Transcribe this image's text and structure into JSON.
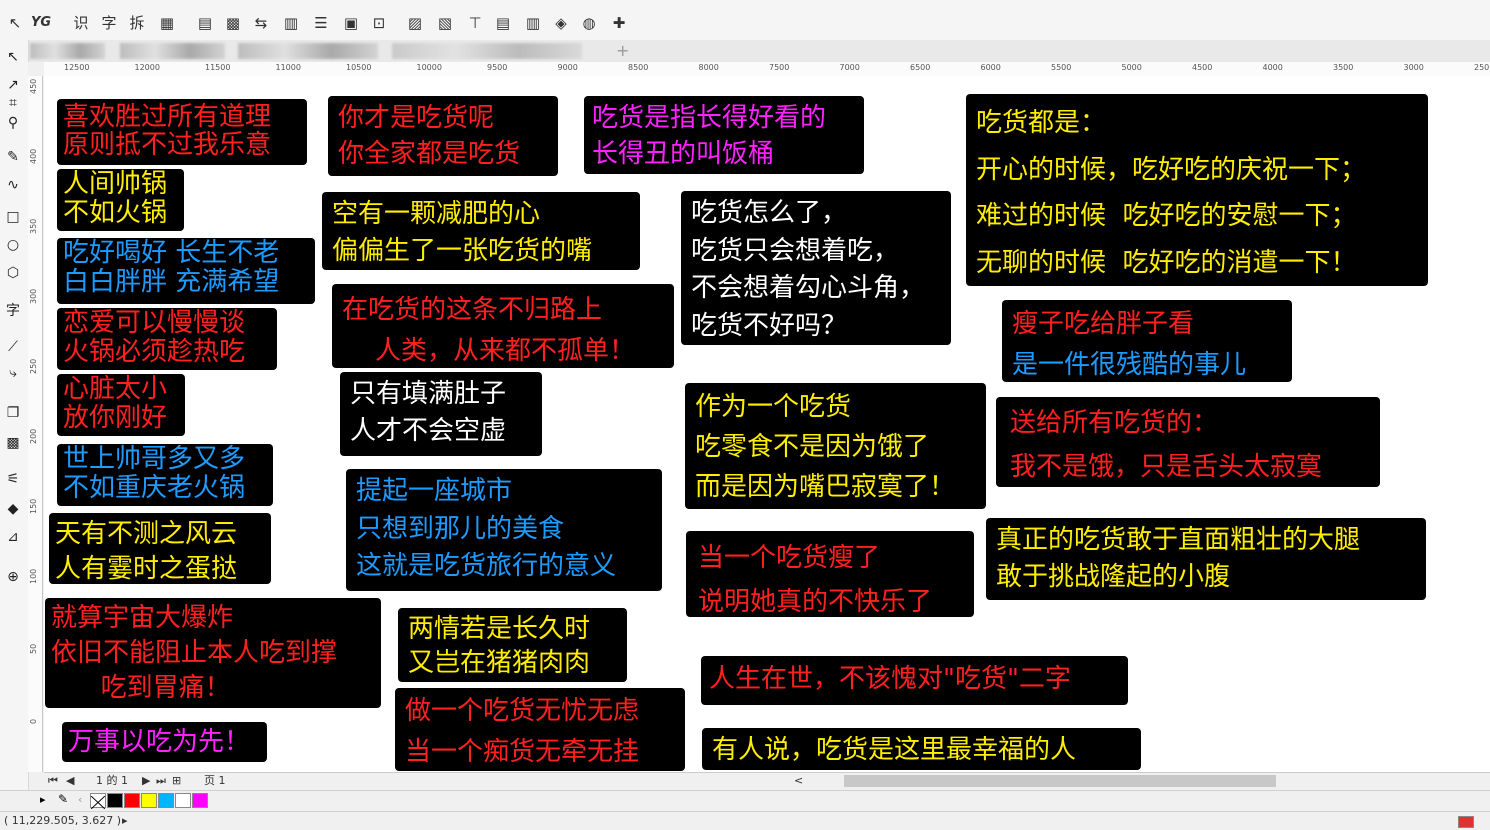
{
  "toolbar": {
    "items": [
      {
        "name": "pointer-icon",
        "glyph": "↖"
      },
      {
        "name": "yg-icon",
        "glyph": "YG"
      },
      {
        "name": "recognize-text-shi",
        "glyph": "识"
      },
      {
        "name": "recognize-text-zi",
        "glyph": "字"
      },
      {
        "name": "recognize-text-chai",
        "glyph": "拆"
      },
      {
        "name": "clipboard-icon",
        "glyph": "▦"
      },
      {
        "name": "document-icon",
        "glyph": "▤"
      },
      {
        "name": "grid-icon",
        "glyph": "▩"
      },
      {
        "name": "transform-icon",
        "glyph": "⇆"
      },
      {
        "name": "align-icon",
        "glyph": "▥"
      },
      {
        "name": "distribute-icon",
        "glyph": "☰"
      },
      {
        "name": "group-icon",
        "glyph": "▣"
      },
      {
        "name": "select-icon",
        "glyph": "⊡"
      },
      {
        "name": "color-icon",
        "glyph": "▨"
      },
      {
        "name": "image-icon",
        "glyph": "▧"
      },
      {
        "name": "text-tool-icon",
        "glyph": "⊤"
      },
      {
        "name": "layers-icon",
        "glyph": "▤"
      },
      {
        "name": "barcode-icon",
        "glyph": "▥"
      },
      {
        "name": "macro-icon",
        "glyph": "◈"
      },
      {
        "name": "globe-icon",
        "glyph": "◍"
      },
      {
        "name": "plugin-icon",
        "glyph": "✚"
      }
    ]
  },
  "tabs": {
    "add_label": "+"
  },
  "toolbox": [
    {
      "name": "pick-tool-icon",
      "glyph": "↖"
    },
    {
      "name": "shape-tool-icon",
      "glyph": "↗"
    },
    {
      "name": "crop-tool-icon",
      "glyph": "⌗"
    },
    {
      "name": "zoom-tool-icon",
      "glyph": "⚲"
    },
    {
      "name": "freehand-tool-icon",
      "glyph": "✎"
    },
    {
      "name": "artistic-media-icon",
      "glyph": "∿"
    },
    {
      "name": "rectangle-tool-icon",
      "glyph": "□"
    },
    {
      "name": "ellipse-tool-icon",
      "glyph": "○"
    },
    {
      "name": "polygon-tool-icon",
      "glyph": "⬡"
    },
    {
      "name": "text-tool-icon",
      "glyph": "字"
    },
    {
      "name": "parallel-dimension-icon",
      "glyph": "⟋"
    },
    {
      "name": "connector-tool-icon",
      "glyph": "⤷"
    },
    {
      "name": "drop-shadow-icon",
      "glyph": "❐"
    },
    {
      "name": "transparency-icon",
      "glyph": "▩"
    },
    {
      "name": "eyedropper-icon",
      "glyph": "⚟"
    },
    {
      "name": "interactive-fill-icon",
      "glyph": "◆"
    },
    {
      "name": "smart-fill-icon",
      "glyph": "⊿"
    },
    {
      "name": "add-tool-icon",
      "glyph": "⊕"
    }
  ],
  "ruler_h": [
    "12500",
    "12000",
    "11500",
    "11000",
    "10500",
    "10000",
    "9500",
    "9000",
    "8500",
    "8000",
    "7500",
    "7000",
    "6500",
    "6000",
    "5500",
    "5000",
    "4500",
    "4000",
    "3500",
    "3000",
    "250"
  ],
  "ruler_v": [
    "450",
    "400",
    "350",
    "300",
    "250",
    "200",
    "150",
    "100",
    "50",
    "0"
  ],
  "cards": [
    {
      "lines": [
        {
          "t": "喜欢胜过所有道理",
          "c": "#ff2020"
        },
        {
          "t": "原则抵不过我乐意",
          "c": "#ff2020"
        }
      ]
    },
    {
      "lines": [
        {
          "t": "你才是吃货呢",
          "c": "#ff2020"
        },
        {
          "t": "你全家都是吃货",
          "c": "#ff2020"
        }
      ]
    },
    {
      "lines": [
        {
          "t": "吃货是指长得好看的",
          "c": "#ff22ff"
        },
        {
          "t": "长得丑的叫饭桶",
          "c": "#ff22ff"
        }
      ]
    },
    {
      "lines": [
        {
          "t": "吃货都是：",
          "c": "#ffee00"
        },
        {
          "t": "开心的时候，吃好吃的庆祝一下；",
          "c": "#ffee00"
        },
        {
          "t": "难过的时候  吃好吃的安慰一下；",
          "c": "#ffee00"
        },
        {
          "t": "无聊的时候  吃好吃的消遣一下！",
          "c": "#ffee00"
        }
      ]
    },
    {
      "lines": [
        {
          "t": "人间帅锅",
          "c": "#ffee00"
        },
        {
          "t": "不如火锅",
          "c": "#ffee00"
        }
      ]
    },
    {
      "lines": [
        {
          "t": "空有一颗减肥的心",
          "c": "#ffee00"
        },
        {
          "t": "偏偏生了一张吃货的嘴",
          "c": "#ffee00"
        }
      ]
    },
    {
      "lines": [
        {
          "t": "吃货怎么了，",
          "c": "#ffffff"
        },
        {
          "t": "吃货只会想着吃，",
          "c": "#ffffff"
        },
        {
          "t": "不会想着勾心斗角，",
          "c": "#ffffff"
        },
        {
          "t": "吃货不好吗？",
          "c": "#ffffff"
        }
      ]
    },
    {
      "lines": [
        {
          "t": "吃好喝好 长生不老",
          "c": "#1e9bff"
        },
        {
          "t": "白白胖胖 充满希望",
          "c": "#1e9bff"
        }
      ]
    },
    {
      "lines": [
        {
          "t": "在吃货的这条不归路上",
          "c": "#ff2020"
        },
        {
          "t": "    人类，从来都不孤单！",
          "c": "#ff2020"
        }
      ]
    },
    {
      "lines": [
        {
          "t": "瘦子吃给胖子看",
          "c": "#ff2020"
        },
        {
          "t": "是一件很残酷的事儿",
          "c": "#1e9bff"
        }
      ]
    },
    {
      "lines": [
        {
          "t": "恋爱可以慢慢谈",
          "c": "#ff2020"
        },
        {
          "t": "火锅必须趁热吃",
          "c": "#ff2020"
        }
      ]
    },
    {
      "lines": [
        {
          "t": "只有填满肚子",
          "c": "#ffffff"
        },
        {
          "t": "人才不会空虚",
          "c": "#ffffff"
        }
      ]
    },
    {
      "lines": [
        {
          "t": "作为一个吃货",
          "c": "#ffee00"
        },
        {
          "t": "吃零食不是因为饿了",
          "c": "#ffee00"
        },
        {
          "t": "而是因为嘴巴寂寞了！",
          "c": "#ffee00"
        }
      ]
    },
    {
      "lines": [
        {
          "t": "心脏太小",
          "c": "#ff2020"
        },
        {
          "t": "放你刚好",
          "c": "#ff2020"
        }
      ]
    },
    {
      "lines": [
        {
          "t": "送给所有吃货的：",
          "c": "#ff2020"
        },
        {
          "t": "我不是饿，只是舌头太寂寞",
          "c": "#ff2020"
        }
      ]
    },
    {
      "lines": [
        {
          "t": "世上帅哥多又多",
          "c": "#1e9bff"
        },
        {
          "t": "不如重庆老火锅",
          "c": "#1e9bff"
        }
      ]
    },
    {
      "lines": [
        {
          "t": "提起一座城市",
          "c": "#1e9bff"
        },
        {
          "t": "只想到那儿的美食",
          "c": "#1e9bff"
        },
        {
          "t": "这就是吃货旅行的意义",
          "c": "#1e9bff"
        }
      ]
    },
    {
      "lines": [
        {
          "t": "天有不测之风云",
          "c": "#ffee00"
        },
        {
          "t": "人有霎时之蛋挞",
          "c": "#ffee00"
        }
      ]
    },
    {
      "lines": [
        {
          "t": "真正的吃货敢于直面粗壮的大腿",
          "c": "#ffee00"
        },
        {
          "t": "敢于挑战隆起的小腹",
          "c": "#ffee00"
        }
      ]
    },
    {
      "lines": [
        {
          "t": "当一个吃货瘦了",
          "c": "#ff2020"
        },
        {
          "t": "说明她真的不快乐了",
          "c": "#ff2020"
        }
      ]
    },
    {
      "lines": [
        {
          "t": "就算宇宙大爆炸",
          "c": "#ff2020"
        },
        {
          "t": "依旧不能阻止本人吃到撑",
          "c": "#ff2020"
        },
        {
          "t": "      吃到胃痛！",
          "c": "#ff2020"
        }
      ]
    },
    {
      "lines": [
        {
          "t": "两情若是长久时",
          "c": "#ffee00"
        },
        {
          "t": "又岂在猪猪肉肉",
          "c": "#ffee00"
        }
      ]
    },
    {
      "lines": [
        {
          "t": "人生在世，不该愧对\"吃货\"二字",
          "c": "#ff2020"
        }
      ]
    },
    {
      "lines": [
        {
          "t": "做一个吃货无忧无虑",
          "c": "#ff2020"
        },
        {
          "t": "当一个痴货无牵无挂",
          "c": "#ff2020"
        }
      ]
    },
    {
      "lines": [
        {
          "t": "万事以吃为先！",
          "c": "#ff22ff"
        }
      ]
    },
    {
      "lines": [
        {
          "t": "有人说，吃货是这里最幸福的人",
          "c": "#ffee00"
        }
      ]
    }
  ],
  "page_nav": {
    "page_counter": "1 的 1",
    "page_tab": "页 1",
    "scroll_left": "<"
  },
  "palette": [
    "#ffffff",
    "#000000",
    "#ff0000",
    "#ffff00",
    "#00b4ff",
    "#ffffff",
    "#ff00ff"
  ],
  "status": {
    "coords": "( 11,229.505, 3.627 )",
    "arrow": "▸"
  }
}
